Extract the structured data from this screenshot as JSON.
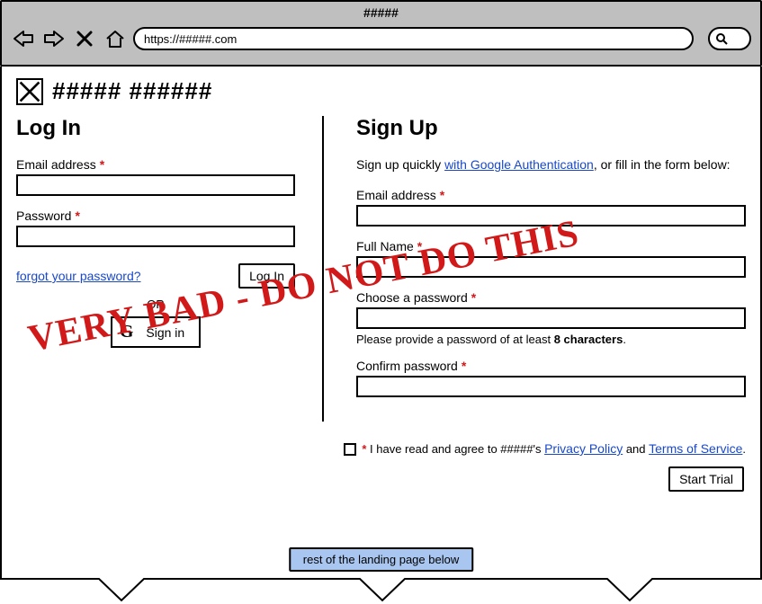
{
  "browser": {
    "title": "#####",
    "url": "https://#####.com"
  },
  "brand": {
    "name": "##### ######"
  },
  "login": {
    "heading": "Log In",
    "email_label": "Email address",
    "password_label": "Password",
    "forgot_link": "forgot your password?",
    "submit_label": "Log In",
    "or_label": "OR",
    "google_signin_label": "Sign in"
  },
  "signup": {
    "heading": "Sign Up",
    "intro_prefix": "Sign up quickly ",
    "intro_link": "with Google Authentication",
    "intro_suffix": ", or fill in the form below:",
    "email_label": "Email address",
    "fullname_label": "Full Name",
    "choose_pw_label": "Choose a password",
    "pw_help_prefix": "Please provide a password of at least ",
    "pw_help_bold": "8 characters",
    "pw_help_suffix": ".",
    "confirm_pw_label": "Confirm password",
    "consent_prefix": " I have read and agree to #####'s ",
    "privacy_link": "Privacy Policy",
    "consent_and": " and ",
    "tos_link": "Terms of Service",
    "consent_suffix": ".",
    "start_trial_label": "Start Trial"
  },
  "footer": {
    "rest_label": "rest of the landing page below"
  },
  "overlay": {
    "warning": "VERY BAD - DO NOT DO THIS"
  },
  "required_star": "*"
}
